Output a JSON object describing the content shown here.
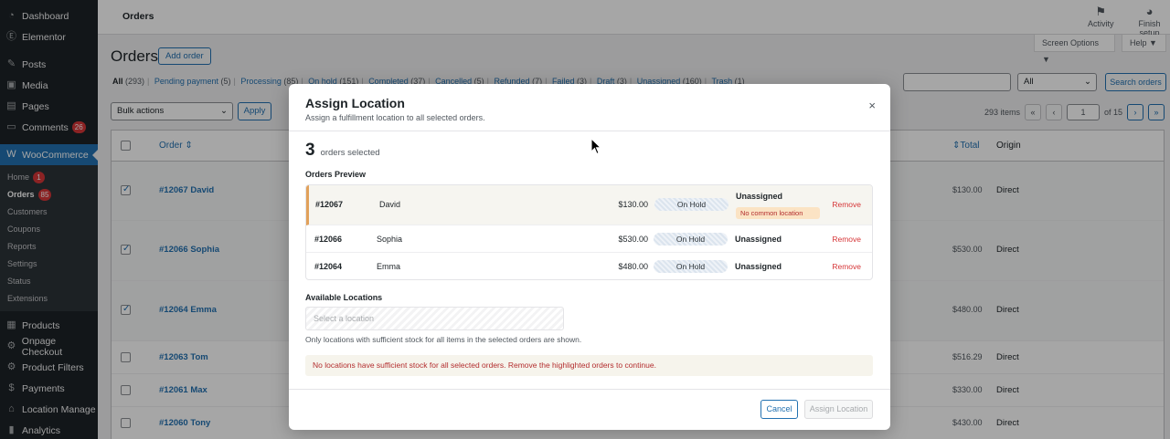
{
  "sidebar": {
    "items": [
      {
        "label": "Dashboard",
        "icon": "dashboard-icon"
      },
      {
        "label": "Elementor",
        "icon": "elementor-icon"
      },
      {
        "label": "Posts",
        "icon": "pin-icon"
      },
      {
        "label": "Media",
        "icon": "media-icon"
      },
      {
        "label": "Pages",
        "icon": "page-icon"
      },
      {
        "label": "Comments",
        "icon": "comment-icon",
        "badge": "26"
      },
      {
        "label": "WooCommerce",
        "icon": "woo-icon"
      }
    ],
    "woo_submenu": [
      {
        "label": "Home",
        "badge": "1"
      },
      {
        "label": "Orders",
        "badge": "85"
      },
      {
        "label": "Customers"
      },
      {
        "label": "Coupons"
      },
      {
        "label": "Reports"
      },
      {
        "label": "Settings"
      },
      {
        "label": "Status"
      },
      {
        "label": "Extensions"
      }
    ],
    "items_after": [
      {
        "label": "Products",
        "icon": "products-icon"
      },
      {
        "label": "Onpage Checkout",
        "icon": "checkout-icon"
      },
      {
        "label": "Product Filters",
        "icon": "filter-icon"
      },
      {
        "label": "Payments",
        "icon": "payments-icon"
      },
      {
        "label": "Location Manage",
        "icon": "location-icon"
      },
      {
        "label": "Analytics",
        "icon": "analytics-icon"
      }
    ]
  },
  "topbar": {
    "title": "Orders",
    "activity": "Activity",
    "finish_setup": "Finish setup",
    "screen_options": "Screen Options ▼",
    "help": "Help ▼"
  },
  "page": {
    "title": "Orders",
    "add_order": "Add order",
    "status_links": [
      {
        "label": "All",
        "count": "(293)",
        "current": true
      },
      {
        "label": "Pending payment",
        "count": "(5)"
      },
      {
        "label": "Processing",
        "count": "(85)"
      },
      {
        "label": "On hold",
        "count": "(151)"
      },
      {
        "label": "Completed",
        "count": "(37)"
      },
      {
        "label": "Cancelled",
        "count": "(5)"
      },
      {
        "label": "Refunded",
        "count": "(7)"
      },
      {
        "label": "Failed",
        "count": "(3)"
      },
      {
        "label": "Draft",
        "count": "(3)"
      },
      {
        "label": "Unassigned",
        "count": "(160)"
      },
      {
        "label": "Trash",
        "count": "(1)"
      }
    ],
    "filter_select": "All",
    "search_button": "Search orders",
    "bulk_actions": "Bulk actions",
    "apply": "Apply",
    "items_count": "293 items",
    "page_current": "1",
    "page_total": "of 15",
    "columns": {
      "order": "Order",
      "total": "Total",
      "origin": "Origin"
    },
    "rows": [
      {
        "order": "#12067 David",
        "total": "$130.00",
        "origin": "Direct",
        "checked": true
      },
      {
        "order": "#12066 Sophia",
        "total": "$530.00",
        "origin": "Direct",
        "checked": true
      },
      {
        "order": "#12064 Emma",
        "total": "$480.00",
        "origin": "Direct",
        "checked": true
      },
      {
        "order": "#12063 Tom",
        "total": "$516.29",
        "origin": "Direct",
        "checked": false
      },
      {
        "order": "#12061 Max",
        "total": "$330.00",
        "origin": "Direct",
        "checked": false
      },
      {
        "order": "#12060 Tony",
        "total": "$430.00",
        "origin": "Direct",
        "checked": false
      }
    ]
  },
  "modal": {
    "title": "Assign Location",
    "subtitle": "Assign a fulfillment location to all selected orders.",
    "close": "×",
    "selected_count": "3",
    "selected_label": "orders selected",
    "preview_label": "Orders Preview",
    "orders": [
      {
        "id": "#12067",
        "name": "David",
        "amount": "$130.00",
        "status": "On Hold",
        "location": "Unassigned",
        "badge": "No common location",
        "remove": "Remove"
      },
      {
        "id": "#12066",
        "name": "Sophia",
        "amount": "$530.00",
        "status": "On Hold",
        "location": "Unassigned",
        "remove": "Remove"
      },
      {
        "id": "#12064",
        "name": "Emma",
        "amount": "$480.00",
        "status": "On Hold",
        "location": "Unassigned",
        "remove": "Remove"
      }
    ],
    "locations_label": "Available Locations",
    "locations_placeholder": "Select a location",
    "hint": "Only locations with sufficient stock for all items in the selected orders are shown.",
    "error": "No locations have sufficient stock for all selected orders. Remove the highlighted orders to continue.",
    "cancel": "Cancel",
    "assign": "Assign Location"
  }
}
